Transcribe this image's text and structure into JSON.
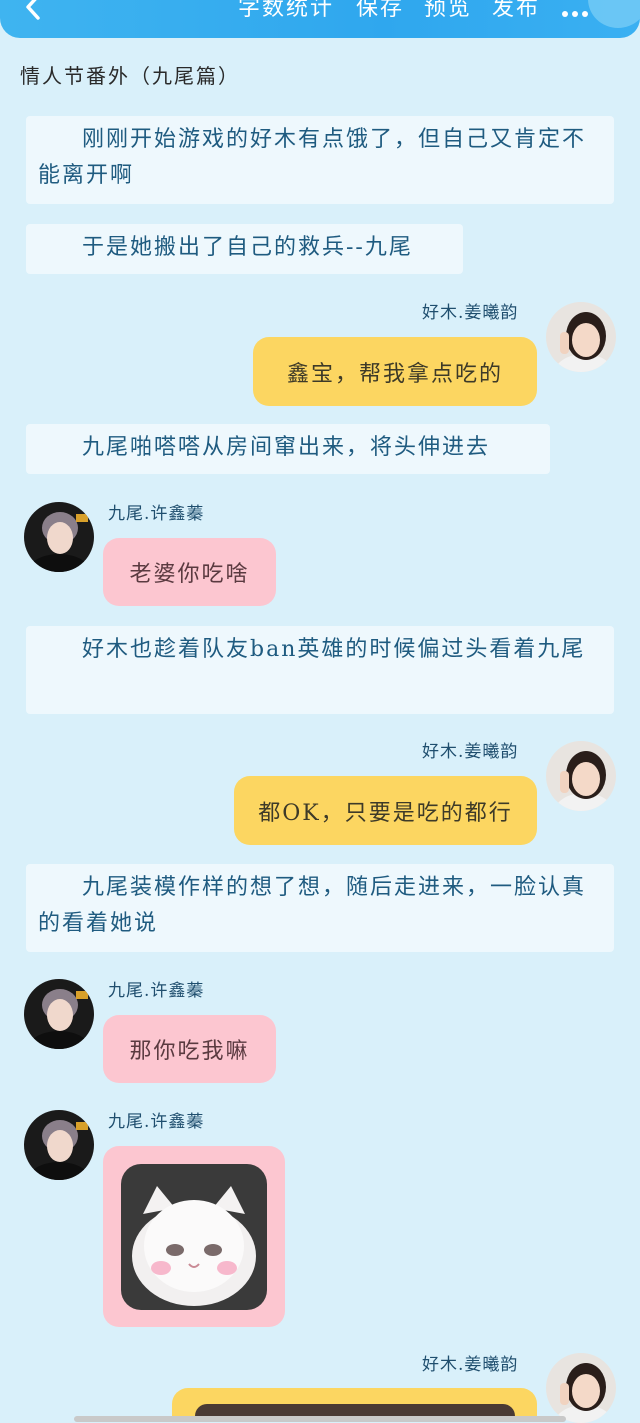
{
  "toolbar": {
    "items": [
      "字数统计",
      "保存",
      "预览",
      "发布"
    ]
  },
  "title": "情人节番外（九尾篇）",
  "narrations": [
    "刚刚开始游戏的好木有点饿了，但自己又肯定不能离开啊",
    "于是她搬出了自己的救兵--九尾",
    "九尾啪嗒嗒从房间窜出来，将头伸进去",
    "好木也趁着队友ban英雄的时候偏过头看着九尾",
    "九尾装模作样的想了想，随后走进来，一脸认真的看着她说"
  ],
  "speakers": {
    "haomu": "好木.姜曦韵",
    "jiuwei": "九尾.许鑫蓁"
  },
  "messages": {
    "m1": "鑫宝，帮我拿点吃的",
    "m2": "老婆你吃啥",
    "m3": "都OK，只要是吃的都行",
    "m4": "那你吃我嘛"
  },
  "colors": {
    "topbar": "#2fa7ee",
    "background": "#d9f0fa",
    "narration_bg": "#eef8fd",
    "bubble_yellow": "#fcd661",
    "bubble_pink": "#fcc6d0"
  },
  "icons": [
    "back-arrow-icon",
    "more-dots-icon"
  ]
}
